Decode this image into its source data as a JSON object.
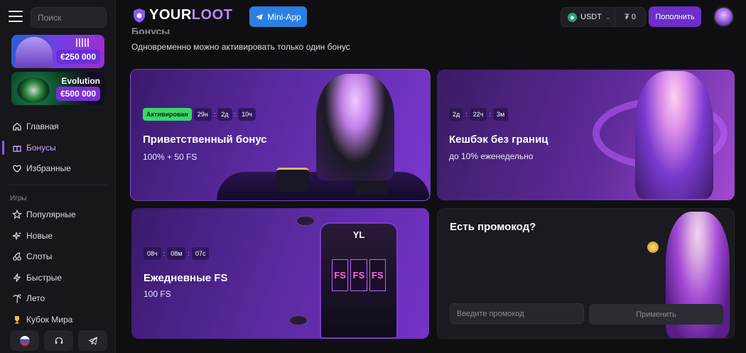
{
  "sidebar": {
    "search_placeholder": "Поиск",
    "promos": [
      {
        "amount": "€250 000"
      },
      {
        "brand": "Evolution",
        "amount": "€500 000"
      }
    ],
    "nav": [
      {
        "label": "Главная",
        "icon": "home-icon"
      },
      {
        "label": "Бонусы",
        "icon": "bonus-icon",
        "active": true
      },
      {
        "label": "Избранные",
        "icon": "heart-icon"
      }
    ],
    "games_label": "Игры",
    "games": [
      {
        "label": "Популярные",
        "icon": "star-icon"
      },
      {
        "label": "Новые",
        "icon": "sparkle-icon"
      },
      {
        "label": "Слоты",
        "icon": "cherry-icon"
      },
      {
        "label": "Быстрые",
        "icon": "lightning-icon"
      },
      {
        "label": "Лето",
        "icon": "palm-icon"
      },
      {
        "label": "Кубок Мира",
        "icon": "trophy-icon"
      }
    ]
  },
  "header": {
    "logo_part1": "YOUR",
    "logo_part2": "LOOT",
    "miniapp_label": "Mini-App",
    "currency": "USDT",
    "balance": "₮ 0",
    "deposit_label": "Пополнить"
  },
  "main": {
    "title": "Бонусы",
    "subtitle": "Одновременно можно активировать только один бонус",
    "cards": [
      {
        "status": "Активирован",
        "timer": [
          "29н",
          "2д",
          "10ч"
        ],
        "title": "Приветственный бонус",
        "sub": "100% + 50 FS"
      },
      {
        "timer": [
          "2д",
          "22ч",
          "3м"
        ],
        "title": "Кешбэк без границ",
        "sub": "до 10% еженедельно"
      },
      {
        "timer": [
          "08ч",
          "08м",
          "07с"
        ],
        "title": "Ежедневные FS",
        "sub": "100 FS",
        "slot_logo": "YL",
        "reel_text": "FS"
      }
    ],
    "promo": {
      "title": "Есть промокод?",
      "input_placeholder": "Введите промокод",
      "apply_label": "Применить"
    }
  },
  "colors": {
    "accent": "#6c2fc9",
    "active_nav": "#c9a6ff",
    "status_green": "#39d86a",
    "miniapp_blue": "#2b7fe0"
  }
}
